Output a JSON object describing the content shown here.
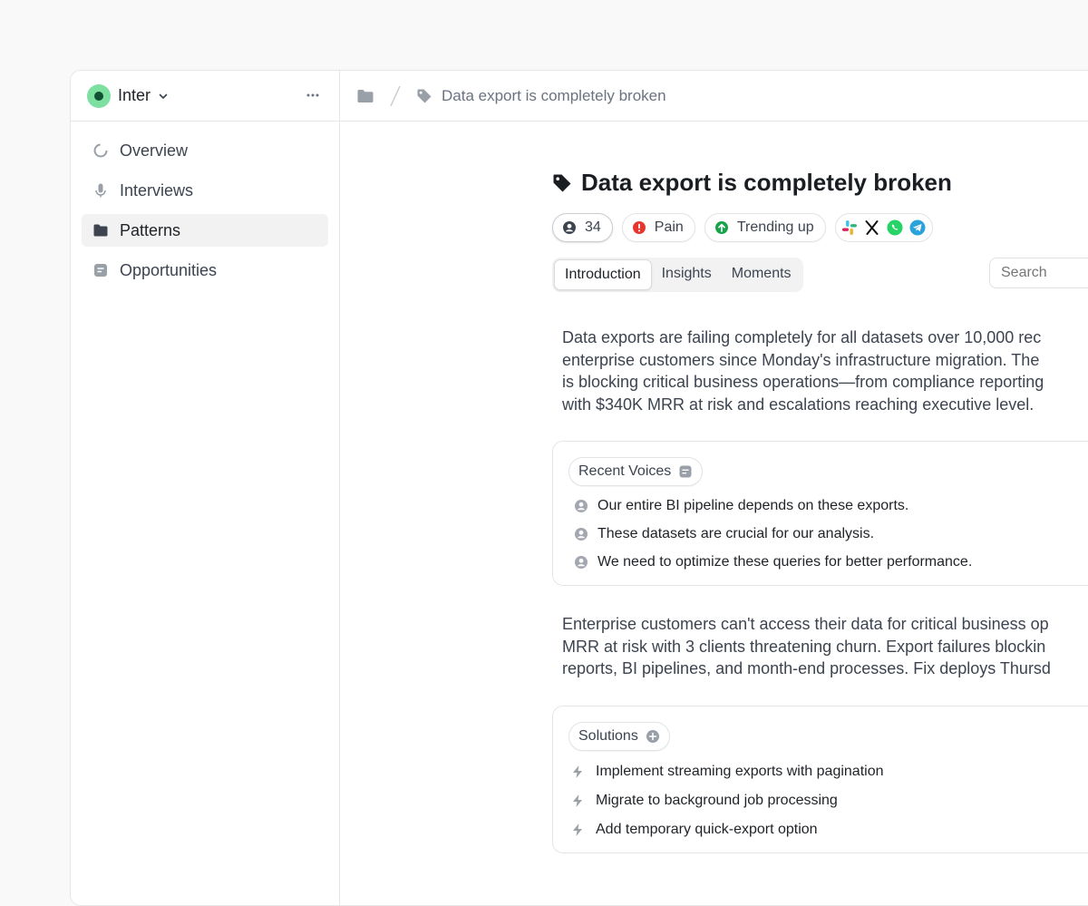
{
  "workspace": {
    "name": "Inter"
  },
  "sidebar": {
    "items": [
      {
        "label": "Overview",
        "icon": "overview-icon",
        "active": false
      },
      {
        "label": "Interviews",
        "icon": "microphone-icon",
        "active": false
      },
      {
        "label": "Patterns",
        "icon": "folder-icon",
        "active": true
      },
      {
        "label": "Opportunities",
        "icon": "note-icon",
        "active": false
      }
    ]
  },
  "breadcrumb": {
    "current": "Data export is completely broken"
  },
  "pattern": {
    "title": "Data export is completely broken",
    "chips": {
      "count": "34",
      "severity": "Pain",
      "trend": "Trending up"
    },
    "sources": [
      "slack-icon",
      "x-icon",
      "whatsapp-icon",
      "telegram-icon"
    ],
    "colors": {
      "severity": "#e5372f",
      "trend": "#16a34a",
      "logo": "#7ddfa0"
    }
  },
  "tabs": [
    {
      "label": "Introduction",
      "active": true
    },
    {
      "label": "Insights",
      "active": false
    },
    {
      "label": "Moments",
      "active": false
    }
  ],
  "search": {
    "placeholder": "Search"
  },
  "intro": {
    "lines": [
      "Data exports are failing completely for all datasets over 10,000 rec",
      "enterprise customers since Monday's infrastructure migration. The",
      "is blocking critical business operations—from compliance reporting",
      "with $340K MRR at risk and escalations reaching executive level."
    ]
  },
  "recent_voices": {
    "label": "Recent Voices",
    "items": [
      "Our entire BI pipeline depends on these exports.",
      "These datasets are crucial for our analysis.",
      "We need to optimize these queries for better performance."
    ]
  },
  "summary": {
    "lines": [
      "Enterprise customers can't access their data for critical business op",
      "MRR at risk with 3 clients threatening churn. Export failures blockin",
      "reports, BI pipelines, and month-end processes. Fix deploys Thursd"
    ]
  },
  "solutions": {
    "label": "Solutions",
    "items": [
      "Implement streaming exports with pagination",
      "Migrate to background job processing",
      "Add temporary quick-export option"
    ]
  }
}
